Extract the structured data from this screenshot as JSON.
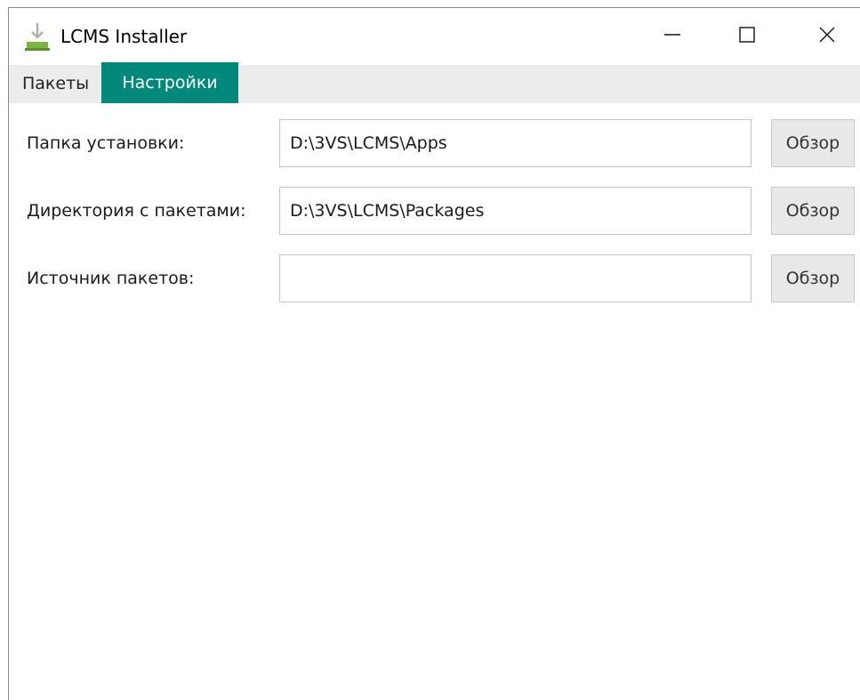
{
  "window": {
    "title": "LCMS Installer",
    "icon": "download-installer-icon",
    "controls": {
      "minimize": "minimize-icon",
      "maximize": "maximize-icon",
      "close": "close-icon"
    }
  },
  "tabs": [
    {
      "label": "Пакеты",
      "active": false
    },
    {
      "label": "Настройки",
      "active": true
    }
  ],
  "settings": {
    "install_folder": {
      "label": "Папка установки:",
      "value": "D:\\3VS\\LCMS\\Apps",
      "button": "Обзор"
    },
    "packages_dir": {
      "label": "Директория с пакетами:",
      "value": "D:\\3VS\\LCMS\\Packages",
      "button": "Обзор"
    },
    "packages_source": {
      "label": "Источник пакетов:",
      "value": "",
      "button": "Обзор"
    }
  },
  "colors": {
    "accent": "#00897b",
    "tabstrip": "#ececec",
    "button_bg": "#e8e8e8"
  }
}
